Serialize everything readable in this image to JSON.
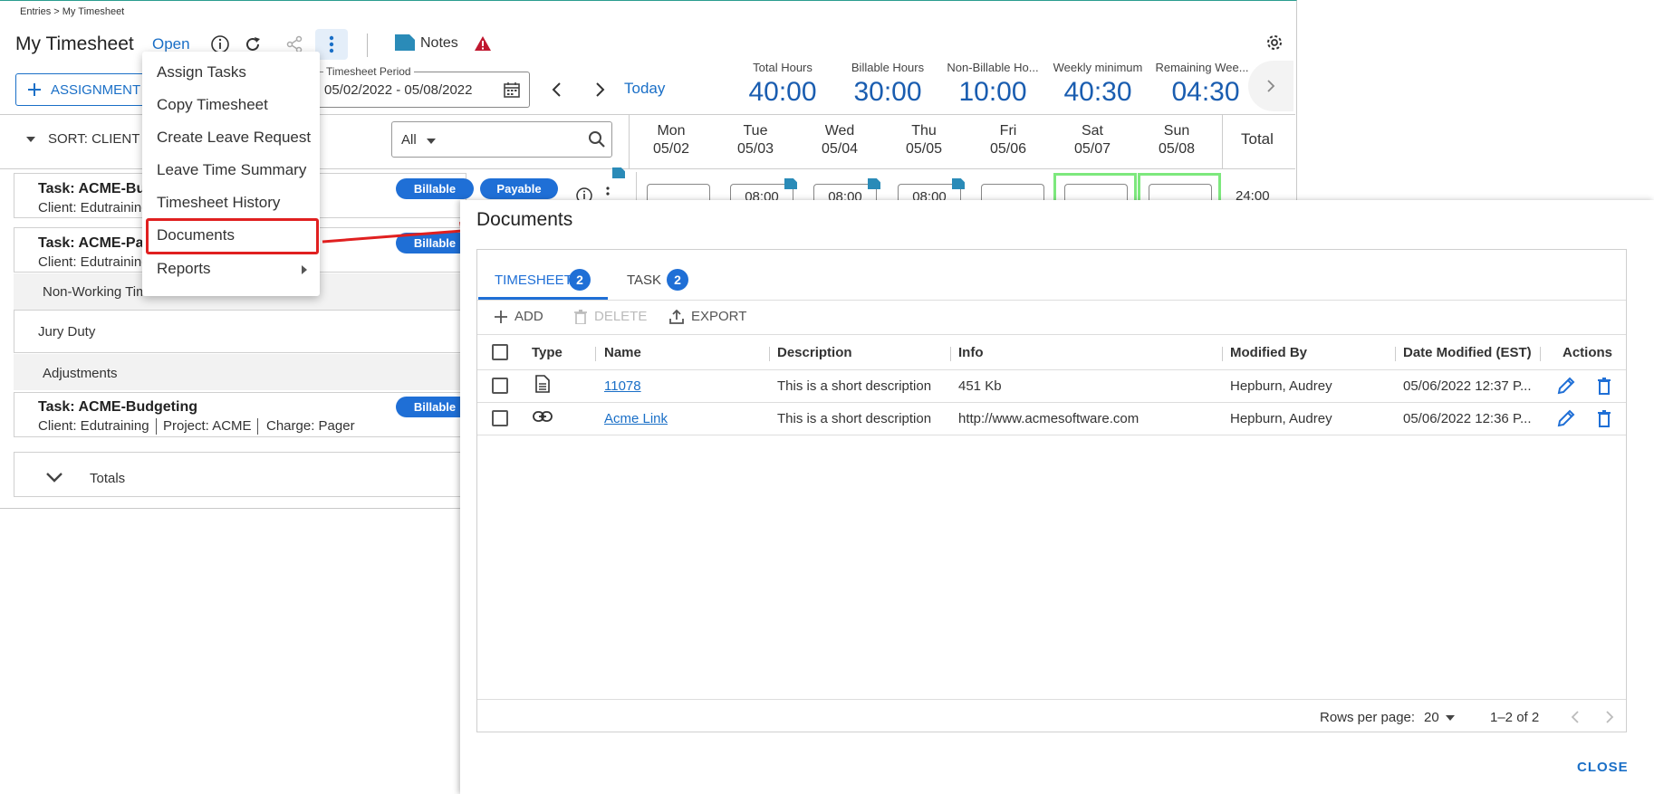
{
  "app": {
    "breadcrumb": "Entries > My Timesheet",
    "title": "My Timesheet",
    "status": "Open",
    "notes_label": "Notes",
    "assign_button_label": "ASSIGNMENT",
    "period": {
      "legend": "Timesheet Period",
      "value": "05/02/2022 - 05/08/2022"
    },
    "today_label": "Today",
    "stats": [
      {
        "label": "Total Hours",
        "value": "40:00"
      },
      {
        "label": "Billable Hours",
        "value": "30:00"
      },
      {
        "label": "Non-Billable Ho...",
        "value": "10:00"
      },
      {
        "label": "Weekly minimum",
        "value": "40:30"
      },
      {
        "label": "Remaining Wee...",
        "value": "04:30"
      }
    ],
    "sort_label": "SORT: CLIENT",
    "filter_value": "All",
    "days": [
      {
        "day": "Mon",
        "date": "05/02"
      },
      {
        "day": "Tue",
        "date": "05/03"
      },
      {
        "day": "Wed",
        "date": "05/04"
      },
      {
        "day": "Thu",
        "date": "05/05"
      },
      {
        "day": "Fri",
        "date": "05/06"
      },
      {
        "day": "Sat",
        "date": "05/07"
      },
      {
        "day": "Sun",
        "date": "05/08"
      }
    ],
    "total_header": "Total",
    "rows": [
      {
        "title": "Task: ACME-Bud",
        "sub": "Client: Edutraining",
        "chips": [
          "Billable",
          "Payable"
        ],
        "hours": [
          "",
          "08:00",
          "08:00",
          "08:00",
          "",
          "",
          ""
        ],
        "total": "24:00"
      },
      {
        "title": "Task: ACME-Payr",
        "sub": "Client: Edutraining",
        "chips": [
          "Billable"
        ]
      }
    ],
    "section_nonworking": "Non-Working Tim",
    "jury_duty": "Jury Duty",
    "section_adjustments": "Adjustments",
    "adjust_row": {
      "title": "Task: ACME-Budgeting",
      "client": "Client: Edutraining",
      "project": "Project: ACME",
      "charge": "Charge: Pager",
      "chip": "Billable"
    },
    "totals_label": "Totals"
  },
  "menu": {
    "items": [
      {
        "label": "Assign Tasks"
      },
      {
        "label": "Copy Timesheet"
      },
      {
        "label": "Create Leave Request"
      },
      {
        "label": "Leave Time Summary"
      },
      {
        "label": "Timesheet History"
      },
      {
        "label": "Documents"
      },
      {
        "label": "Reports"
      }
    ]
  },
  "dialog": {
    "title": "Documents",
    "tabs": [
      {
        "label": "TIMESHEET",
        "count": "2"
      },
      {
        "label": "TASK",
        "count": "2"
      }
    ],
    "toolbar": {
      "add": "ADD",
      "delete": "DELETE",
      "export": "EXPORT"
    },
    "columns": {
      "type": "Type",
      "name": "Name",
      "description": "Description",
      "info": "Info",
      "modified_by": "Modified By",
      "date_modified": "Date Modified (EST)",
      "actions": "Actions"
    },
    "rows": [
      {
        "type_icon": "file-icon",
        "name": "11078",
        "description": "This is a short description",
        "info": "451 Kb",
        "modified_by": "Hepburn, Audrey",
        "date_modified": "05/06/2022 12:37 P..."
      },
      {
        "type_icon": "link-icon",
        "name": "Acme Link",
        "description": "This is a short description",
        "info": "http://www.acmesoftware.com",
        "modified_by": "Hepburn, Audrey",
        "date_modified": "05/06/2022 12:36 P..."
      }
    ],
    "pagination": {
      "rows_per_page_label": "Rows per page:",
      "rows_per_page": "20",
      "range": "1–2 of 2"
    },
    "close_label": "CLOSE"
  },
  "colors": {
    "accent": "#1f6fd6",
    "highlight": "#e02020",
    "weekend_border": "#7de87d",
    "note_flag": "#2a8bb8"
  }
}
